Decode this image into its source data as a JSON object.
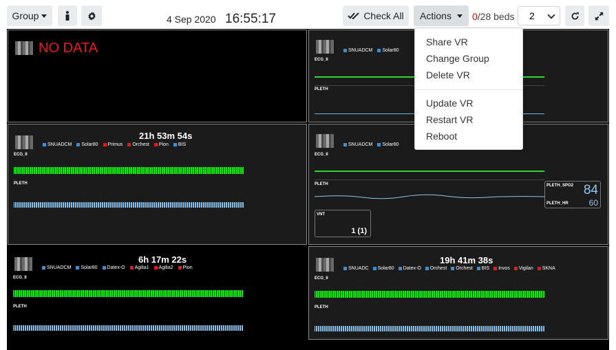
{
  "toolbar": {
    "group_label": "Group",
    "date": "4 Sep 2020",
    "time": "16:55:17",
    "check_all_label": "Check All",
    "actions_label": "Actions",
    "beds_zero": "0",
    "beds_rest": "/28 beds",
    "columns_value": "2"
  },
  "actions_menu": {
    "items_top": [
      "Share VR",
      "Change Group",
      "Delete VR"
    ],
    "items_bottom": [
      "Update VR",
      "Restart VR",
      "Reboot"
    ]
  },
  "cells": {
    "c1": {
      "status": "NO DATA"
    },
    "c2": {
      "legend": [
        "SNUADCM",
        "Solar80"
      ],
      "ecg_label": "ECG_II",
      "pleth_label": "PLETH"
    },
    "c3": {
      "duration": "21h 53m 54s",
      "legend": [
        "SNUADCM",
        "Solar80",
        "Primus",
        "Orchest",
        "Pion",
        "BIS"
      ],
      "ecg_label": "ECG_II",
      "pleth_label": "PLETH"
    },
    "c4": {
      "legend": [
        "SNUADCM",
        "Solar80"
      ],
      "ecg_label": "ECG_II",
      "pleth_label": "PLETH",
      "spo2_label": "PLETH_SPO2",
      "spo2_value": "84",
      "hr_label": "PLETH_HR",
      "hr_value": "60",
      "vnt_label": "VNT",
      "vnt_value": "1 (1)"
    },
    "c5": {
      "duration": "6h 17m 22s",
      "legend": [
        "SNUADCM",
        "Solar80",
        "Datex-O",
        "Agilia1",
        "Agilia2",
        "Pion"
      ],
      "ecg_label": "ECG_II",
      "pleth_label": "PLETH"
    },
    "c6": {
      "duration": "19h 41m 38s",
      "legend": [
        "SNUADC",
        "Solar80",
        "Datex-O",
        "Orchest",
        "Orchest",
        "BIS",
        "Invos",
        "Vigilan",
        "SKNA"
      ],
      "ecg_label": "ECG_II",
      "pleth_label": "PLETH"
    }
  },
  "colors": {
    "blue": "#3d8fd6",
    "red": "#e8191b",
    "ecg": "#00ff00",
    "pleth": "#8ec8f0"
  }
}
